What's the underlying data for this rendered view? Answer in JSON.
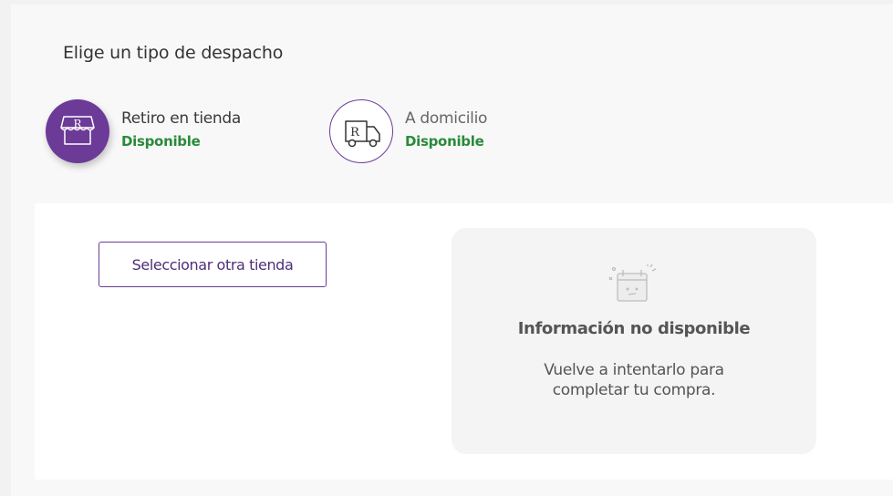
{
  "header": {
    "title": "Elige un tipo de despacho"
  },
  "shipping_options": [
    {
      "label": "Retiro en tienda",
      "status": "Disponible",
      "icon": "store-icon",
      "selected": true
    },
    {
      "label": "A domicilio",
      "status": "Disponible",
      "icon": "truck-icon",
      "selected": false
    }
  ],
  "store_selection": {
    "button_label": "Seleccionar otra tienda"
  },
  "info_card": {
    "icon": "sad-calendar-icon",
    "title": "Información no disponible",
    "message": "Vuelve a intentarlo para completar tu compra."
  },
  "colors": {
    "brand": "#6c3a97",
    "available": "#2a8a3a",
    "card_bg": "#f4f4f4"
  }
}
